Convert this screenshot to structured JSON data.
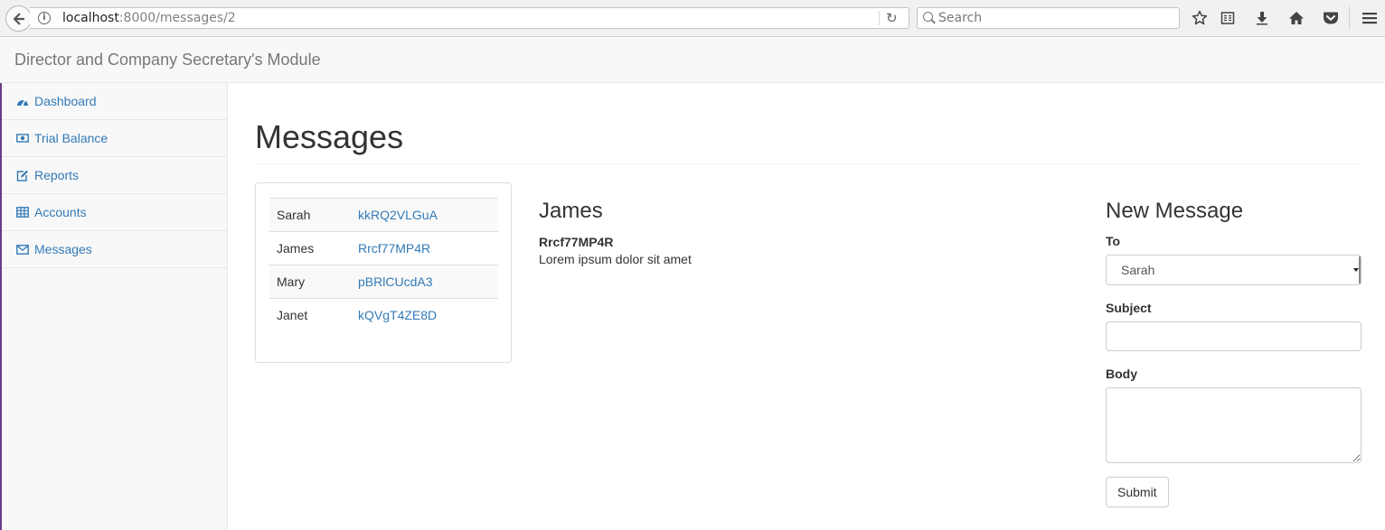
{
  "browser": {
    "url_host": "localhost",
    "url_path": ":8000/messages/2",
    "search_placeholder": "Search",
    "icons": [
      "back-arrow-icon",
      "info-icon",
      "reload-icon",
      "search-icon",
      "bookmark-star-icon",
      "reading-list-icon",
      "download-icon",
      "home-icon",
      "pocket-icon",
      "hamburger-menu-icon"
    ]
  },
  "navbar": {
    "brand": "Director and Company Secretary's Module"
  },
  "sidebar": {
    "items": [
      {
        "label": "Dashboard",
        "icon": "dashboard-icon"
      },
      {
        "label": "Trial Balance",
        "icon": "money-icon"
      },
      {
        "label": "Reports",
        "icon": "edit-icon"
      },
      {
        "label": "Accounts",
        "icon": "table-icon"
      },
      {
        "label": "Messages",
        "icon": "envelope-icon"
      }
    ]
  },
  "main": {
    "title": "Messages",
    "messages": [
      {
        "sender": "Sarah",
        "subject": "kkRQ2VLGuA"
      },
      {
        "sender": "James",
        "subject": "Rrcf77MP4R"
      },
      {
        "sender": "Mary",
        "subject": "pBRlCUcdA3"
      },
      {
        "sender": "Janet",
        "subject": "kQVgT4ZE8D"
      }
    ],
    "detail": {
      "sender": "James",
      "subject": "Rrcf77MP4R",
      "body": "Lorem ipsum dolor sit amet"
    },
    "form": {
      "title": "New Message",
      "to_label": "To",
      "to_value": "Sarah",
      "subject_label": "Subject",
      "subject_value": "",
      "body_label": "Body",
      "body_value": "",
      "submit_label": "Submit"
    }
  },
  "colors": {
    "link": "#337ab7",
    "navbar_bg": "#f8f8f8",
    "sidebar_accent": "#6c3a86"
  }
}
